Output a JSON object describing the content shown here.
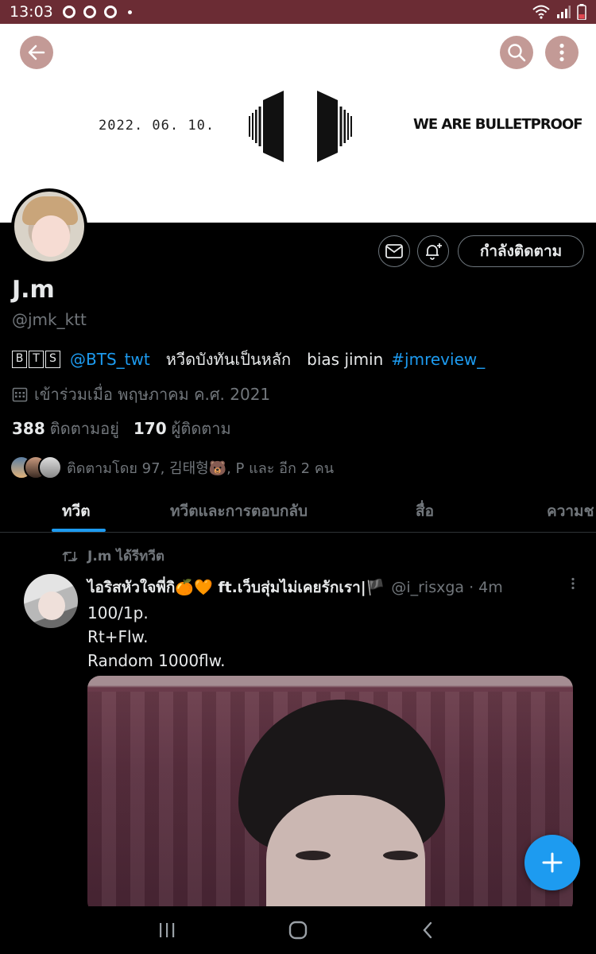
{
  "status_bar": {
    "time": "13:03"
  },
  "banner": {
    "date": "2022. 06. 10.",
    "slogan": "WE ARE BULLETPROOF"
  },
  "profile": {
    "following_button": "กำลังติดตาม",
    "display_name": "J.m",
    "handle": "@jmk_ktt",
    "bio": {
      "letters": [
        "B",
        "T",
        "S"
      ],
      "mention": "@BTS_twt",
      "text_1": "หวีดบังทันเป็นหลัก",
      "text_2": "bias jimin",
      "hashtag": "#jmreview_"
    },
    "joined": "เข้าร่วมเมื่อ พฤษภาคม ค.ศ. 2021",
    "following_count": "388",
    "following_label": "ติดตามอยู่",
    "followers_count": "170",
    "followers_label": "ผู้ติดตาม",
    "followed_by": "ติดตามโดย 97, 김태형🐻, P และ อีก 2 คน"
  },
  "tabs": [
    {
      "label": "ทวีต",
      "active": true
    },
    {
      "label": "ทวีตและการตอบกลับ",
      "active": false
    },
    {
      "label": "สื่อ",
      "active": false
    },
    {
      "label": "ความช",
      "active": false
    }
  ],
  "tweet": {
    "retweet_label": "J.m ได้รีทวีต",
    "author_name": "ไอริสหัวใจพี่กิ🍊🧡 ft.เว็บสุ่มไม่เคยรักเรา|🏴",
    "author_meta": "@i_risxga · 4m",
    "lines": [
      "100/1p.",
      "Rt+Flw.",
      "Random 1000flw."
    ]
  },
  "colors": {
    "accent": "#1d9bf0",
    "status_bar": "#6b2c34",
    "banner": "#ffffff"
  },
  "icons": {
    "back": "arrow-left-icon",
    "search": "search-icon",
    "more": "more-vertical-icon",
    "message": "envelope-icon",
    "notify": "bell-plus-icon",
    "calendar": "calendar-icon",
    "retweet": "retweet-icon",
    "compose": "plus-icon"
  }
}
